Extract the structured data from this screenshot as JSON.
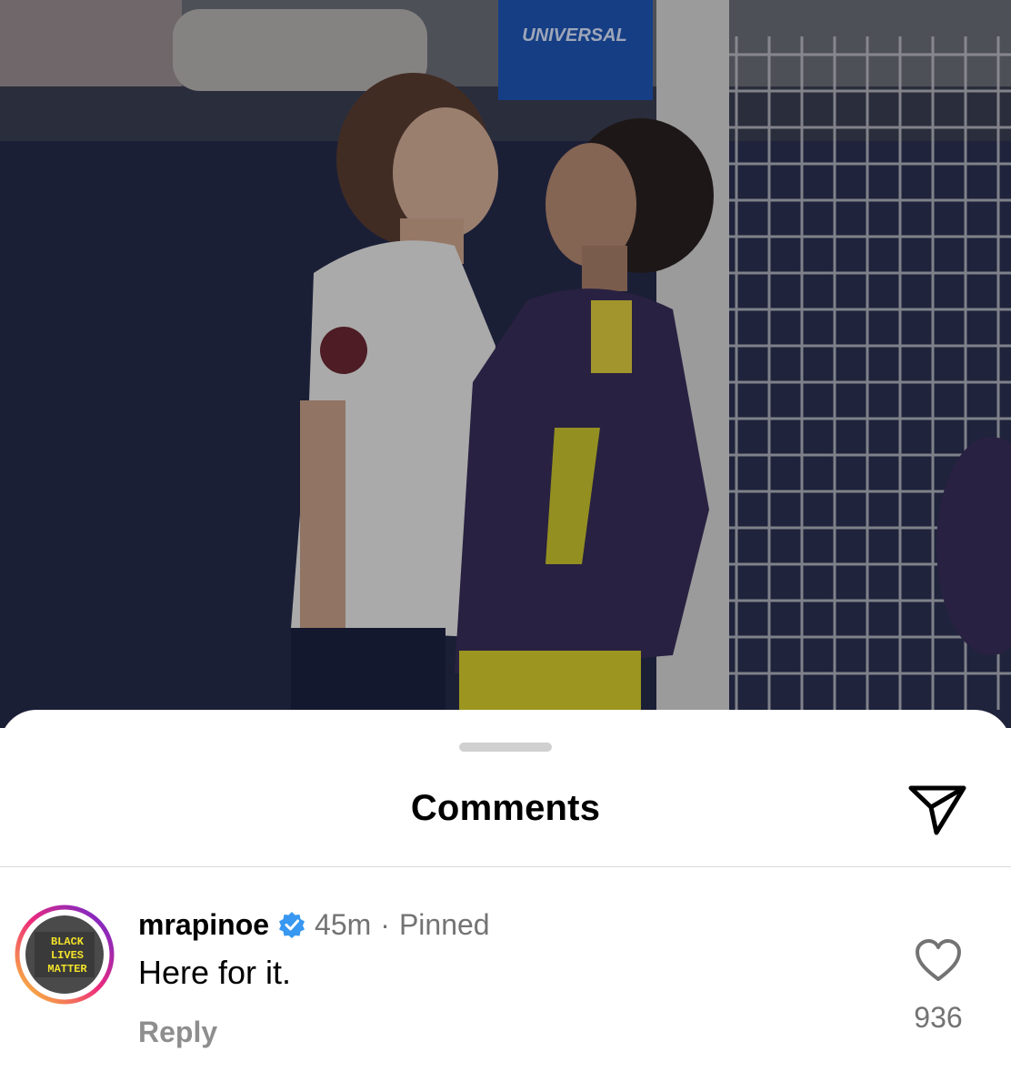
{
  "sheet": {
    "title": "Comments"
  },
  "comment": {
    "username": "mrapinoe",
    "time": "45m",
    "separator": "·",
    "pinned_label": "Pinned",
    "text": "Here for it.",
    "reply_label": "Reply",
    "like_count": "936",
    "avatar_text": [
      "BLACK",
      "LIVES",
      "MATTER"
    ]
  },
  "media": {
    "banner_text": "UNIVERSAL"
  },
  "colors": {
    "verified_badge": "#3897f0",
    "secondary_text": "#737373",
    "avatar_ring_start": "#f9ce34",
    "avatar_ring_mid": "#ee2a7b",
    "avatar_ring_end": "#6228d7"
  },
  "icons": {
    "share": "paper-plane-icon",
    "like": "heart-outline-icon",
    "verified": "verified-badge-icon"
  }
}
